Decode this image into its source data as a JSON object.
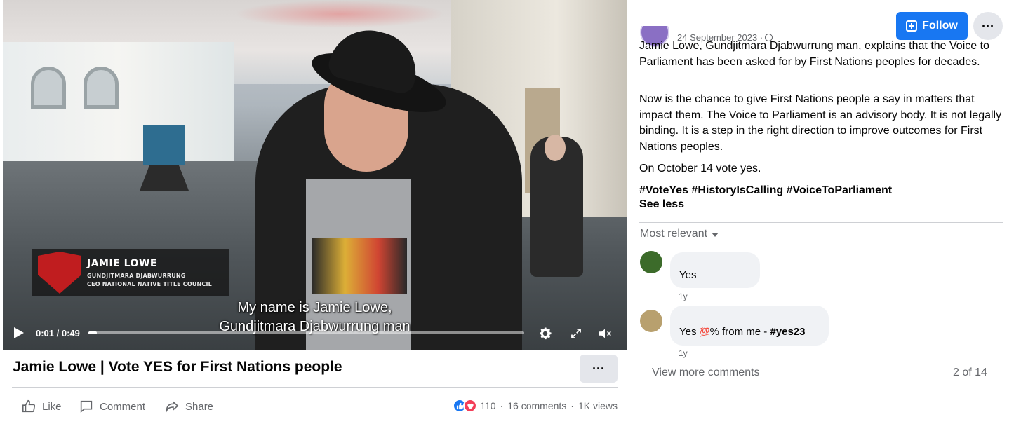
{
  "video": {
    "lower_third": {
      "name": "JAMIE LOWE",
      "line1": "GUNDJITMARA DJABWURRUNG",
      "line2": "CEO NATIONAL NATIVE TITLE COUNCIL"
    },
    "caption_line1": "My name is Jamie Lowe,",
    "caption_line2": "Gundjitmara Djabwurrung man",
    "time_display": "0:01 / 0:49",
    "progress_fraction": 0.02,
    "icons": [
      "play-icon",
      "gear-icon",
      "expand-icon",
      "volume-icon"
    ]
  },
  "video_title": "Jamie Lowe | Vote YES for First Nations people",
  "actions": {
    "like": "Like",
    "comment": "Comment",
    "share": "Share"
  },
  "stats": {
    "reactions_count": "110",
    "comments": "16 comments",
    "views": "1K views",
    "separator": "·"
  },
  "post": {
    "date": "24 September 2023 ·",
    "follow_label": "Follow",
    "paragraph1": "Jamie Lowe, Gundjitmara Djabwurrung man, explains that the Voice to Parliament has been asked for by First Nations peoples for decades.",
    "paragraph2": "Now is the chance to give First Nations people a say in matters that impact them. The Voice to Parliament is an advisory body. It is not legally binding. It is a step in the right direction to improve outcomes for First Nations peoples.",
    "paragraph3": "On October 14 vote yes.",
    "hashtags": "#VoteYes #HistoryIsCalling #VoiceToParliament",
    "see_less": "See less"
  },
  "comments_section": {
    "sort_label": "Most relevant",
    "comments": [
      {
        "text": "Yes",
        "time": "1y"
      },
      {
        "text_before": "Yes ",
        "emoji": "💯",
        "text_after": "% from me - ",
        "hashtag": "#yes23",
        "time": "1y"
      }
    ],
    "view_more": "View more comments",
    "count": "2 of 14"
  },
  "colors": {
    "accent": "#1877f2",
    "love": "#f33e58",
    "muted_text": "#65676b",
    "bubble_bg": "#f0f2f5"
  }
}
